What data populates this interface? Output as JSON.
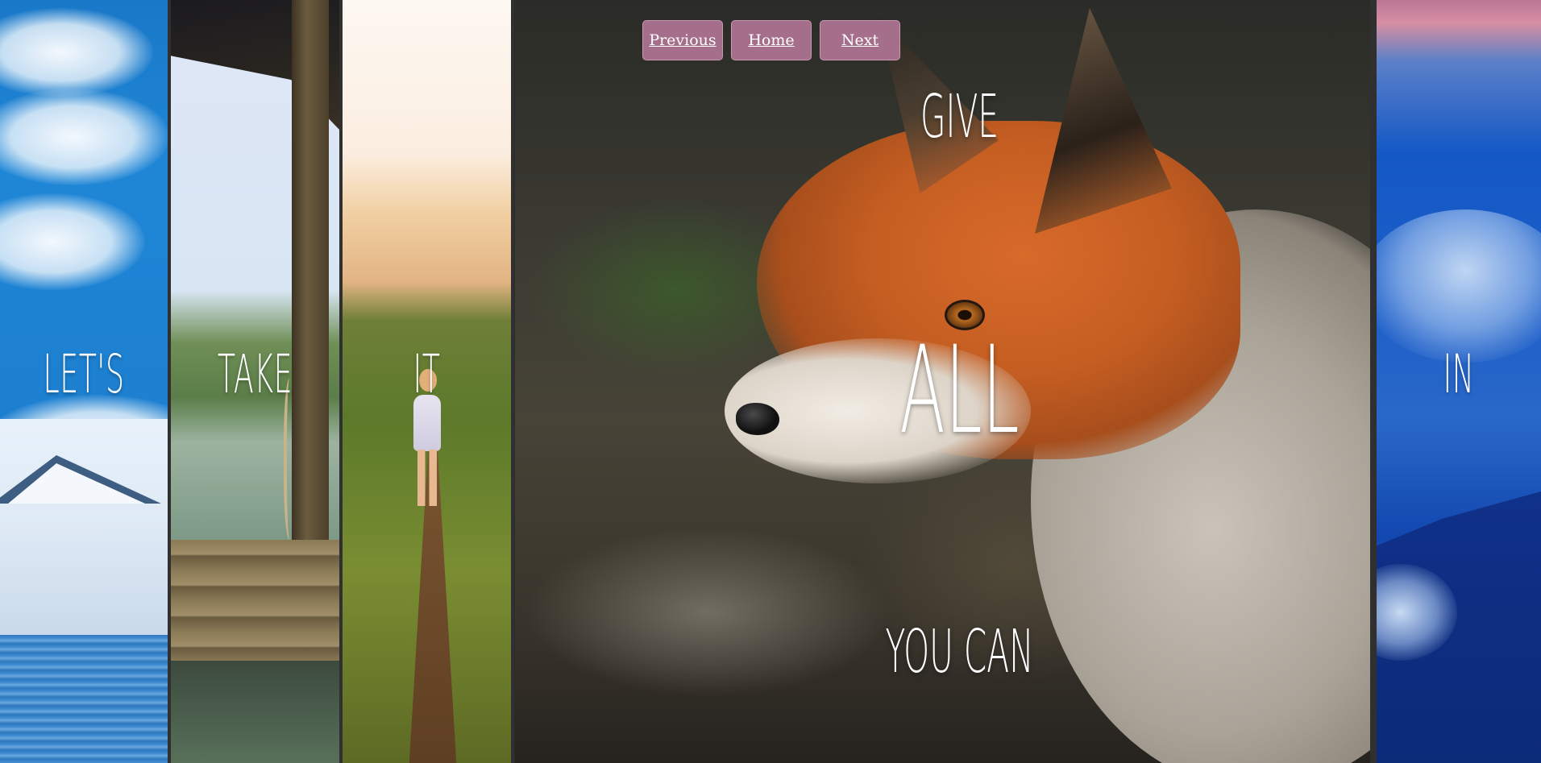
{
  "nav": {
    "previous_label": "Previous",
    "home_label": "Home",
    "next_label": "Next",
    "button_color": "#a56e8a"
  },
  "panels": [
    {
      "word": "LET'S",
      "scene": "sky-mountains-lake"
    },
    {
      "word": "TAKE",
      "scene": "dock-jungle-water"
    },
    {
      "word": "IT",
      "scene": "hiker-trail-sunset"
    },
    {
      "words": [
        "GIVE",
        "ALL",
        "YOU CAN"
      ],
      "scene": "red-fox"
    },
    {
      "word": "IN",
      "scene": "blue-clouds"
    }
  ]
}
